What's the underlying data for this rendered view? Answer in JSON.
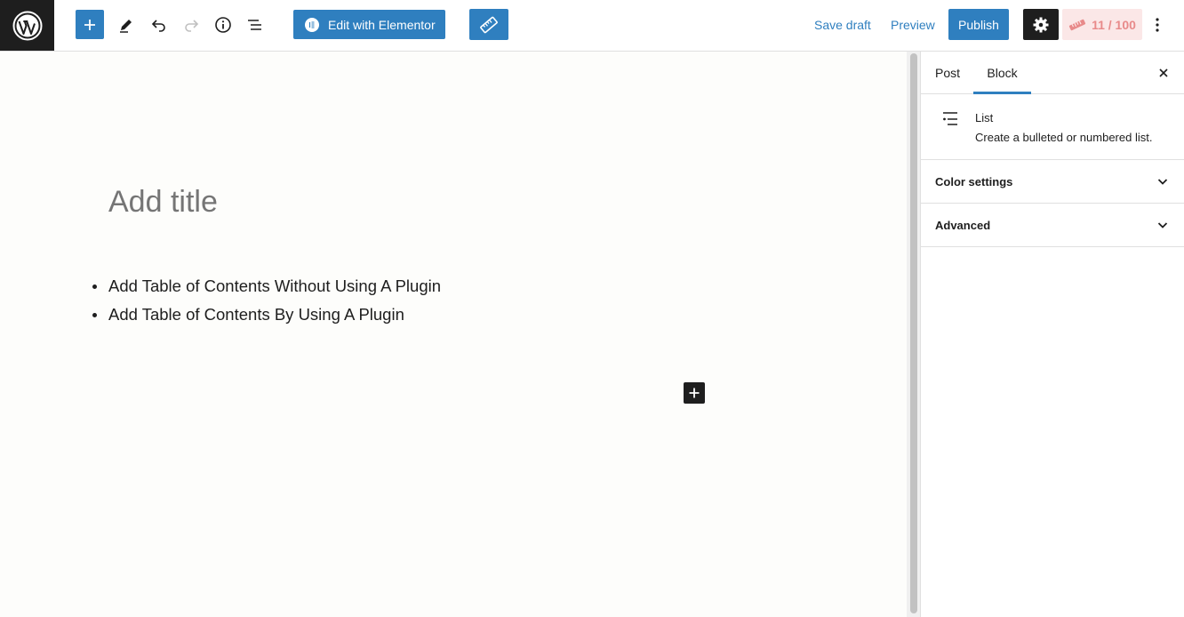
{
  "toolbar": {
    "elementor_label": "Edit with Elementor",
    "save_draft": "Save draft",
    "preview": "Preview",
    "publish": "Publish",
    "seo_score": "11 / 100"
  },
  "editor": {
    "title_placeholder": "Add title",
    "list_items": [
      "Add Table of Contents Without Using A Plugin",
      "Add Table of Contents By Using A Plugin"
    ]
  },
  "sidebar": {
    "tabs": [
      "Post",
      "Block"
    ],
    "active_tab": "Block",
    "block_name": "List",
    "block_description": "Create a bulleted or numbered list.",
    "panels": [
      "Color settings",
      "Advanced"
    ]
  },
  "colors": {
    "accent": "#2f7fbf",
    "dark": "#1e1e1e",
    "seo_bg": "#fbe7e7",
    "seo_text": "#e88a8a"
  }
}
